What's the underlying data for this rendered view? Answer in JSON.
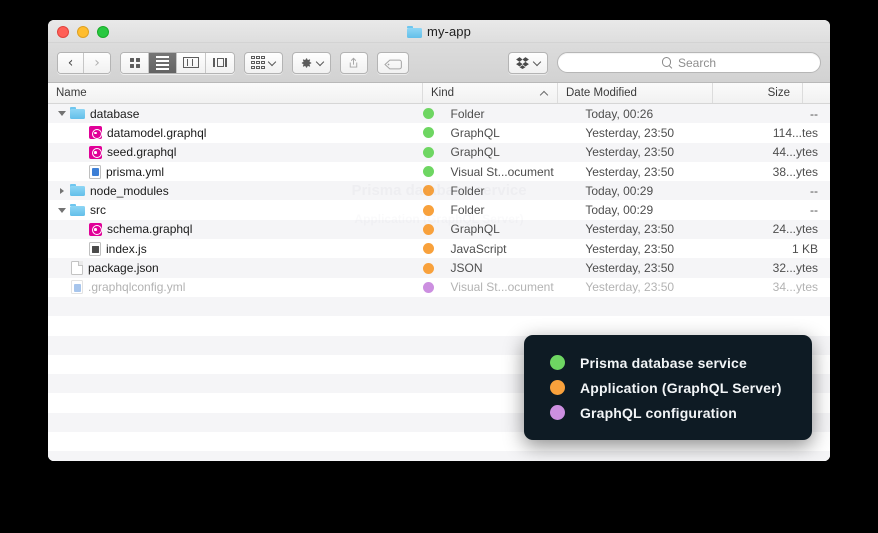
{
  "window": {
    "title": "my-app",
    "title_icon": "folder-icon",
    "traffic_lights": [
      "close-red",
      "minimize-yellow",
      "zoom-green"
    ]
  },
  "toolbar": {
    "back_label": "‹",
    "forward_label": "›",
    "view_buttons": [
      {
        "name": "icon-view",
        "selected": false
      },
      {
        "name": "list-view",
        "selected": true
      },
      {
        "name": "column-view",
        "selected": false
      },
      {
        "name": "gallery-view",
        "selected": false
      }
    ],
    "arrange_icon": "arrange-grid-icon",
    "action_icon": "gear-icon",
    "share_icon": "share-icon",
    "tag_icon": "tag-icon",
    "dropbox_icon": "dropbox-icon"
  },
  "search": {
    "icon": "search-icon",
    "placeholder": "Search",
    "value": ""
  },
  "columns": {
    "name": "Name",
    "kind": "Kind",
    "date_modified": "Date Modified",
    "size": "Size",
    "sorted_by": "Kind",
    "sort_direction": "ascending"
  },
  "tag_colors": {
    "green": "#6ed662",
    "orange": "#f8a13c",
    "purple": "#cc8fe0"
  },
  "files": [
    {
      "name": "database",
      "icon": "folder-icon",
      "indent": 0,
      "disclosure": "open",
      "tag": "green",
      "kind": "Folder",
      "date": "Today, 00:26",
      "size": "--",
      "dimmed": false
    },
    {
      "name": "datamodel.graphql",
      "icon": "graphql-icon",
      "indent": 1,
      "disclosure": "none",
      "tag": "green",
      "kind": "GraphQL",
      "date": "Yesterday, 23:50",
      "size": "114...tes",
      "dimmed": false
    },
    {
      "name": "seed.graphql",
      "icon": "graphql-icon",
      "indent": 1,
      "disclosure": "none",
      "tag": "green",
      "kind": "GraphQL",
      "date": "Yesterday, 23:50",
      "size": "44...ytes",
      "dimmed": false
    },
    {
      "name": "prisma.yml",
      "icon": "yml-document-icon",
      "indent": 1,
      "disclosure": "none",
      "tag": "green",
      "kind": "Visual St...ocument",
      "date": "Yesterday, 23:50",
      "size": "38...ytes",
      "dimmed": false
    },
    {
      "name": "node_modules",
      "icon": "folder-icon",
      "indent": 0,
      "disclosure": "closed",
      "tag": "orange",
      "kind": "Folder",
      "date": "Today, 00:29",
      "size": "--",
      "dimmed": false
    },
    {
      "name": "src",
      "icon": "folder-icon",
      "indent": 0,
      "disclosure": "open",
      "tag": "orange",
      "kind": "Folder",
      "date": "Today, 00:29",
      "size": "--",
      "dimmed": false
    },
    {
      "name": "schema.graphql",
      "icon": "graphql-icon",
      "indent": 1,
      "disclosure": "none",
      "tag": "orange",
      "kind": "GraphQL",
      "date": "Yesterday, 23:50",
      "size": "24...ytes",
      "dimmed": false
    },
    {
      "name": "index.js",
      "icon": "javascript-document-icon",
      "indent": 1,
      "disclosure": "none",
      "tag": "orange",
      "kind": "JavaScript",
      "date": "Yesterday, 23:50",
      "size": "1 KB",
      "dimmed": false
    },
    {
      "name": "package.json",
      "icon": "document-icon",
      "indent": 0,
      "disclosure": "none",
      "tag": "orange",
      "kind": "JSON",
      "date": "Yesterday, 23:50",
      "size": "32...ytes",
      "dimmed": false
    },
    {
      "name": ".graphqlconfig.yml",
      "icon": "yml-document-icon",
      "indent": 0,
      "disclosure": "none",
      "tag": "purple",
      "kind": "Visual St...ocument",
      "date": "Yesterday, 23:50",
      "size": "34...ytes",
      "dimmed": true
    }
  ],
  "watermark": {
    "line1": "Prisma database service",
    "line2": "Application (GraphQL Server)"
  },
  "legend": {
    "items": [
      {
        "color": "#6ed662",
        "label": "Prisma database service"
      },
      {
        "color": "#f8a13c",
        "label": "Application (GraphQL Server)"
      },
      {
        "color": "#cc8fe0",
        "label": "GraphQL configuration"
      }
    ]
  }
}
